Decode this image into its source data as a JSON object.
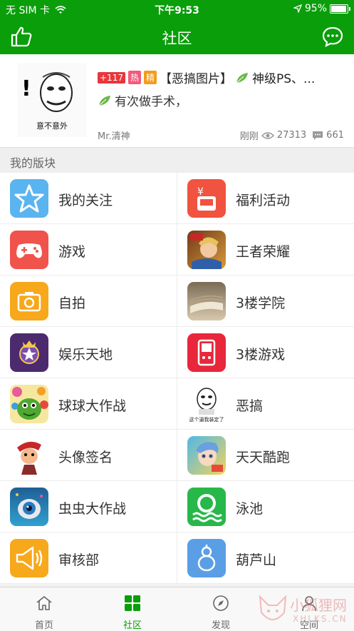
{
  "status_bar": {
    "carrier": "无 SIM 卡",
    "time": "下午9:53",
    "battery": "95%",
    "battery_level": 0.95
  },
  "header": {
    "title": "社区"
  },
  "post": {
    "thumb_caption": "意不意外",
    "tags": [
      {
        "text": "+117",
        "color": "#e8363c"
      },
      {
        "text": "热",
        "color": "#f25a79"
      },
      {
        "text": "精",
        "color": "#f39b1c"
      }
    ],
    "title": "【恶搞图片】",
    "title_rest": "神级PS、...",
    "subtitle": "有次做手术，",
    "author": "Mr.清神",
    "time": "刚刚",
    "views": "27313",
    "comments": "661"
  },
  "section": {
    "title": "我的版块"
  },
  "boards": [
    {
      "left": {
        "label": "我的关注",
        "icon": "star-icon",
        "color": "#5ab4ef"
      },
      "right": {
        "label": "福利活动",
        "icon": "gift-icon",
        "color": "#f0533f"
      }
    },
    {
      "left": {
        "label": "游戏",
        "icon": "gamepad-icon",
        "color": "#f0534b"
      },
      "right": {
        "label": "王者荣耀",
        "icon": "honor-of-kings-icon",
        "color": "#6e3a1a"
      }
    },
    {
      "left": {
        "label": "自拍",
        "icon": "camera-icon",
        "color": "#f7a81b"
      },
      "right": {
        "label": "3楼学院",
        "icon": "book-icon",
        "color": "#b9a485"
      }
    },
    {
      "left": {
        "label": "娱乐天地",
        "icon": "entertainment-icon",
        "color": "#4b2a6e"
      },
      "right": {
        "label": "3楼游戏",
        "icon": "handheld-console-icon",
        "color": "#e8273b"
      }
    },
    {
      "left": {
        "label": "球球大作战",
        "icon": "ball-battle-icon",
        "color": "#3b8e3b"
      },
      "right": {
        "label": "恶搞",
        "icon": "meme-face-icon",
        "color": "#ffffff"
      },
      "right_caption": "这个逼我装定了"
    },
    {
      "left": {
        "label": "头像签名",
        "icon": "avatar-character-icon",
        "color": "#ffffff"
      },
      "right": {
        "label": "天天酷跑",
        "icon": "runner-character-icon",
        "color": "#4fb8e8"
      }
    },
    {
      "left": {
        "label": "虫虫大作战",
        "icon": "eye-creature-icon",
        "color": "#1f7fb5"
      },
      "right": {
        "label": "泳池",
        "icon": "lifebuoy-icon",
        "color": "#28b84a"
      }
    },
    {
      "left": {
        "label": "审核部",
        "icon": "megaphone-icon",
        "color": "#f7a81b"
      },
      "right": {
        "label": "葫芦山",
        "icon": "gourd-icon",
        "color": "#5a9ee6"
      }
    }
  ],
  "tabs": [
    {
      "label": "首页",
      "icon": "home-icon",
      "active": false
    },
    {
      "label": "社区",
      "icon": "grid-icon",
      "active": true
    },
    {
      "label": "发现",
      "icon": "compass-icon",
      "active": false
    },
    {
      "label": "空间",
      "icon": "person-icon",
      "active": false
    }
  ],
  "watermark": {
    "text": "小狐狸网",
    "sub": "XHLKS.CN"
  },
  "colors": {
    "brand_green": "#0a9e0a",
    "tab_active": "#0a9e0a"
  }
}
